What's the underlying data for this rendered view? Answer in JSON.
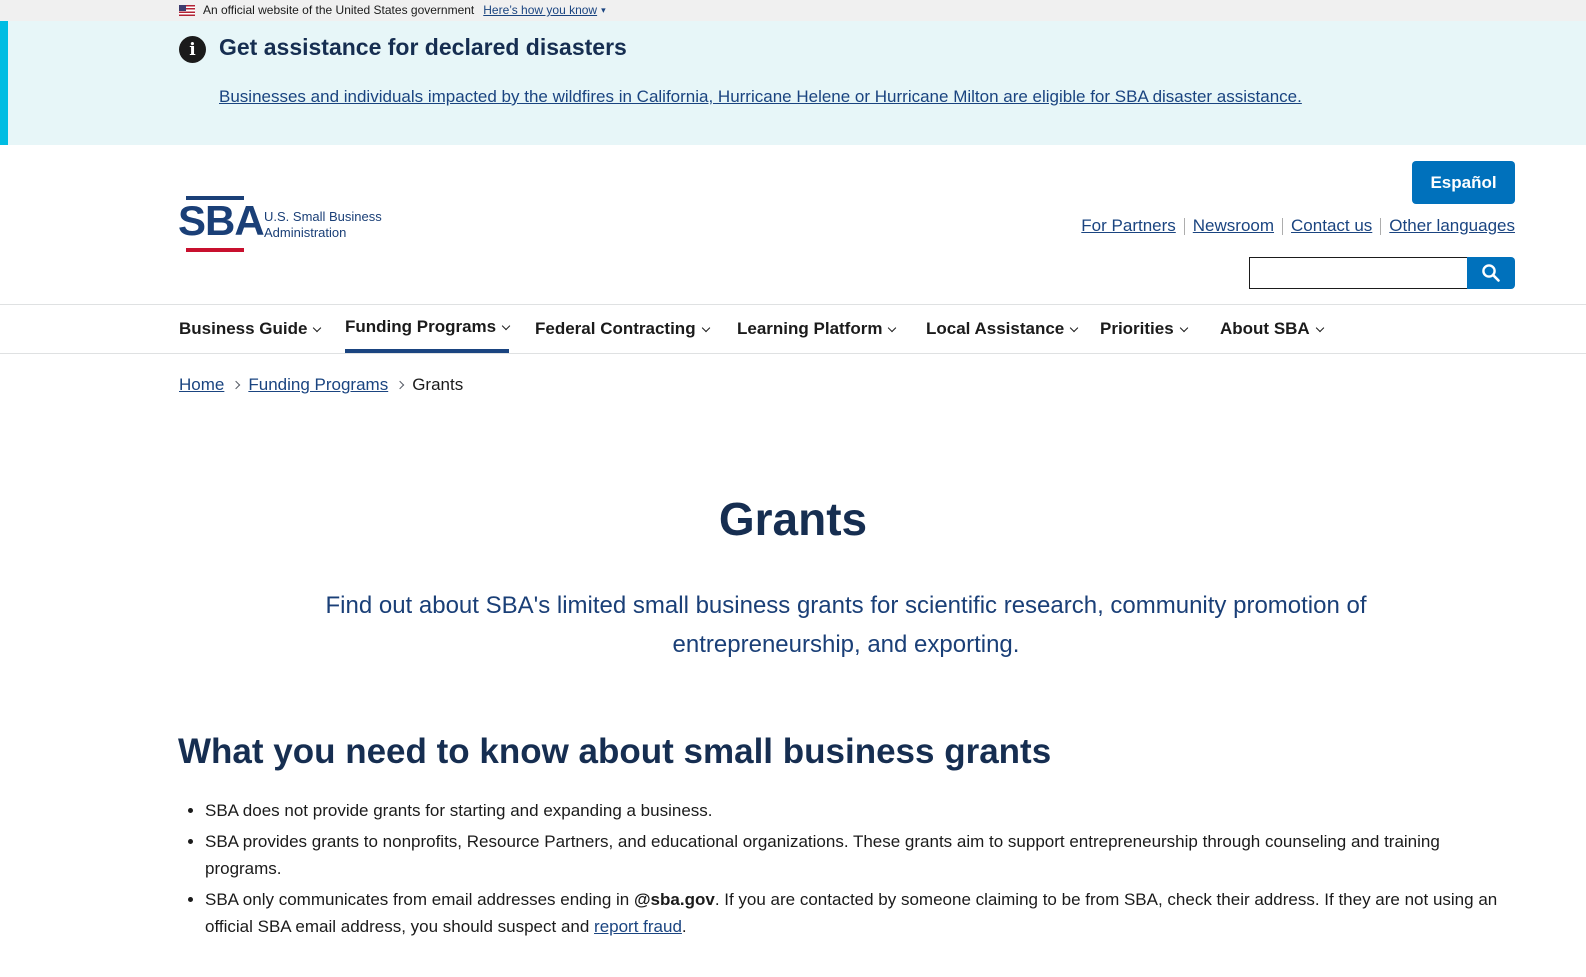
{
  "gov_banner": {
    "text": "An official website of the United States government",
    "how_link": "Here’s how you know"
  },
  "alert": {
    "title": "Get assistance for declared disasters",
    "link": "Businesses and individuals impacted by the wildfires in California, Hurricane Helene or Hurricane Milton are eligible for SBA disaster assistance."
  },
  "logo": {
    "mark": "SBA",
    "line1": "U.S. Small Business",
    "line2": "Administration"
  },
  "header": {
    "espanol": "Español",
    "links": [
      "For Partners",
      "Newsroom",
      "Contact us",
      "Other languages"
    ],
    "search_value": ""
  },
  "nav": [
    {
      "label": "Business Guide",
      "active": false
    },
    {
      "label": "Funding Programs",
      "active": true
    },
    {
      "label": "Federal Contracting",
      "active": false
    },
    {
      "label": "Learning Platform",
      "active": false
    },
    {
      "label": "Local Assistance",
      "active": false
    },
    {
      "label": "Priorities",
      "active": false
    },
    {
      "label": "About SBA",
      "active": false
    }
  ],
  "breadcrumb": {
    "home": "Home",
    "parent": "Funding Programs",
    "current": "Grants"
  },
  "main": {
    "title": "Grants",
    "intro": "Find out about SBA's limited small business grants for scientific research, community promotion of entrepreneurship, and exporting.",
    "section_title": "What you need to know about small business grants",
    "bullet1": "SBA does not provide grants for starting and expanding a business.",
    "bullet2": "SBA provides grants to nonprofits, Resource Partners, and educational organizations. These grants aim to support entrepreneurship through counseling and training programs.",
    "bullet3_before": "SBA only communicates from email addresses ending in ",
    "bullet3_bold": "@sba.gov",
    "bullet3_middle": ". If you are contacted by someone claiming to be from SBA, check their address. If they are not using an official SBA email address, you should suspect and ",
    "bullet3_link": "report fraud",
    "bullet3_end": "."
  },
  "colors": {
    "primary": "#0071bc",
    "navy": "#162e51",
    "link": "#1a4480",
    "alert_bg": "#e7f6f8",
    "alert_bar": "#00bde3",
    "logo_red": "#c8102e"
  }
}
